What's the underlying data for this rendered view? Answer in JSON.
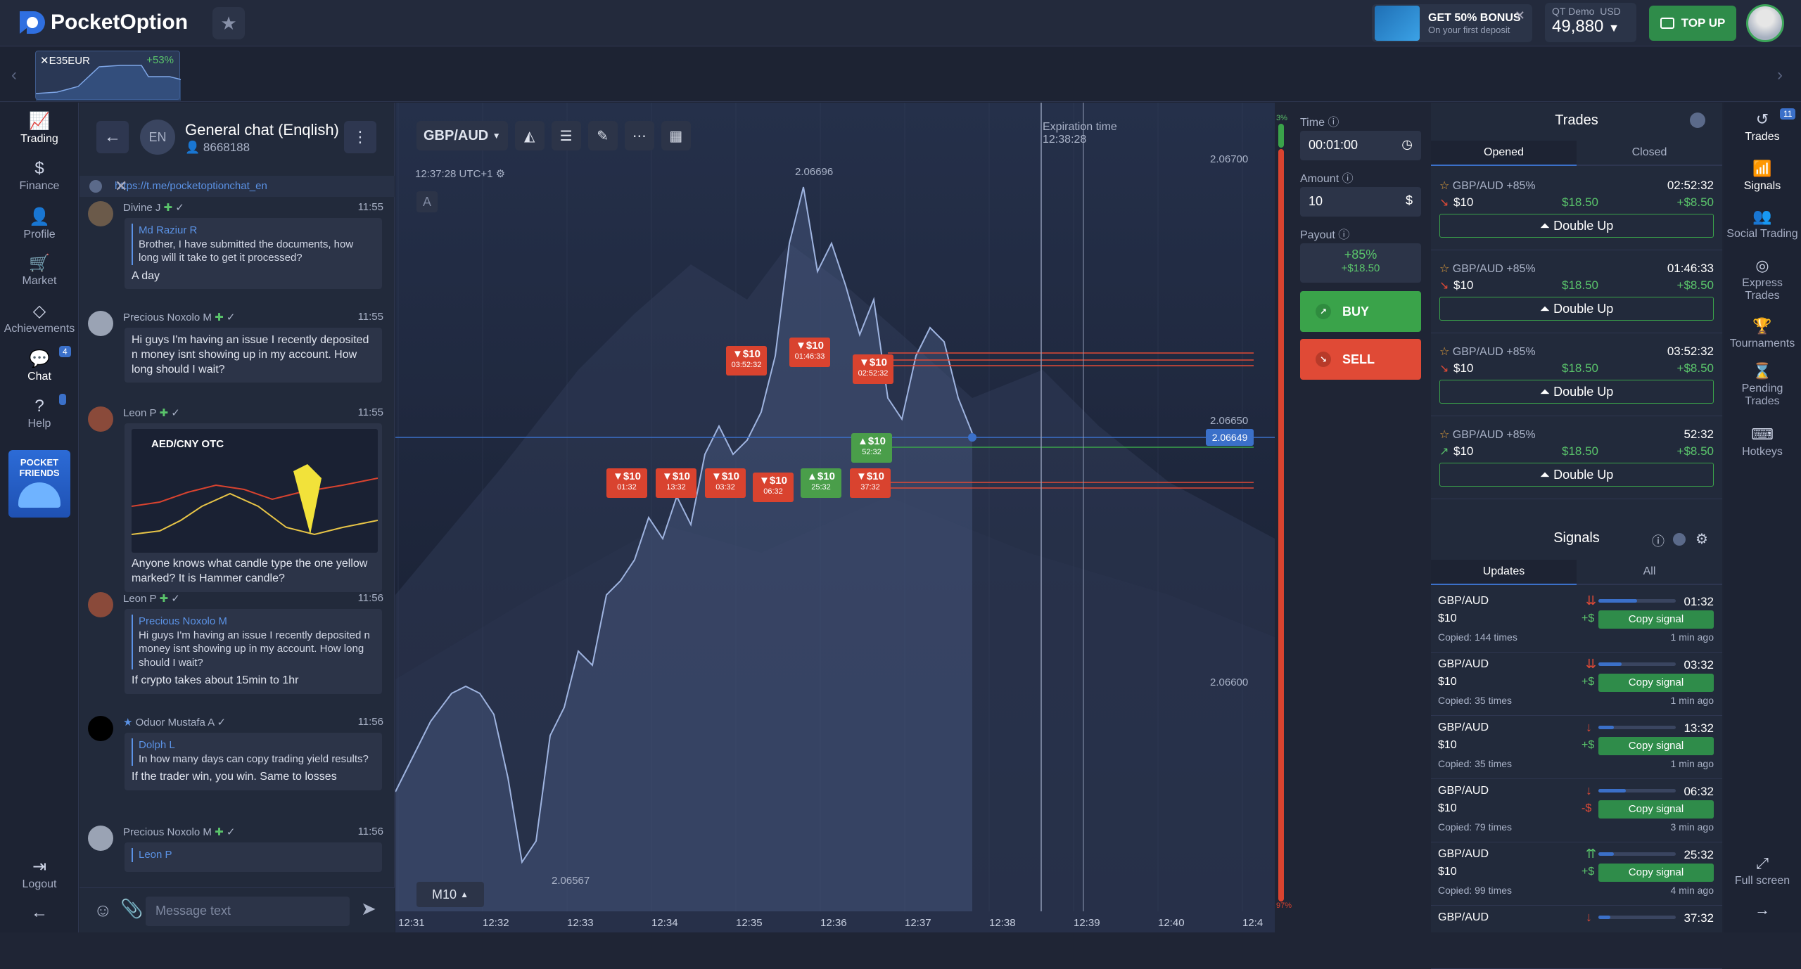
{
  "app": {
    "brand_prefix": "Pocket",
    "brand_suffix": "Option"
  },
  "header": {
    "bonus_title": "GET 50% BONUS",
    "bonus_sub": "On your first deposit",
    "account_mode": "QT Demo",
    "currency": "USD",
    "balance": "49,880",
    "topup_label": "TOP UP"
  },
  "asset_tab": {
    "name": "E35EUR",
    "pct": "+53%"
  },
  "left_nav": {
    "trading": "Trading",
    "finance": "Finance",
    "profile": "Profile",
    "market": "Market",
    "achievements": "Achievements",
    "chat": "Chat",
    "chat_badge": "4",
    "help": "Help",
    "promo_line1": "POCKET",
    "promo_line2": "FRIENDS",
    "logout": "Logout"
  },
  "chat": {
    "avatar": "EN",
    "title": "General chat (Enqlish)",
    "count": "8668188",
    "link": "https://t.me/pocketoptionchat_en",
    "input_placeholder": "Message text",
    "messages": [
      {
        "name": "Divine J",
        "time": "11:55",
        "quote_name": "Md Raziur R",
        "quote_text": "Brother, I have submitted the documents, how long will it take to get it processed?",
        "text": "A day"
      },
      {
        "name": "Precious Noxolo M",
        "time": "11:55",
        "text": "Hi guys I'm having an issue I recently deposited n money isnt showing up in my account. How long should I wait?"
      },
      {
        "name": "Leon P",
        "time": "11:55",
        "text": "Anyone knows what candle type the one yellow marked? It is Hammer candle?",
        "img_pair": "AED/CNY OTC"
      },
      {
        "name": "Leon P",
        "time": "11:56",
        "quote_name": "Precious Noxolo M",
        "quote_text": "Hi guys I'm having an issue I recently deposited n money isnt showing up in my account. How long should I wait?",
        "text": "If crypto takes about 15min to 1hr"
      },
      {
        "name": "Oduor Mustafa A",
        "time": "11:56",
        "quote_name": "Dolph L",
        "quote_text": "In how many days can copy trading yield results?",
        "text": "If the trader win, you win. Same to losses"
      },
      {
        "name": "Precious Noxolo M",
        "time": "11:56",
        "quote_name": "Leon P",
        "quote_text": "",
        "text": ""
      }
    ]
  },
  "chart": {
    "pair": "GBP/AUD",
    "time": "12:37:28 UTC+1",
    "mark_a": "A",
    "expiration_label": "Expiration time",
    "expiration_time": "12:38:28",
    "timeframe": "M10",
    "current_price": "2.06649",
    "high_label": "2.06696",
    "low_label": "2.06567",
    "price_ticks": [
      "2.06700",
      "2.06650",
      "2.06600"
    ],
    "x_ticks": [
      "12:31",
      "12:32",
      "12:33",
      "12:34",
      "12:35",
      "12:36",
      "12:37",
      "12:38",
      "12:39",
      "12:40",
      "12:4"
    ],
    "vbar_top": "3%",
    "vbar_bottom": "97%",
    "trade_tags": [
      {
        "amount": "$10",
        "timer": "03:52:32",
        "dir": "down"
      },
      {
        "amount": "$10",
        "timer": "01:46:33",
        "dir": "down"
      },
      {
        "amount": "$10",
        "timer": "02:52:32",
        "dir": "down"
      },
      {
        "amount": "$10",
        "timer": "52:32",
        "dir": "up"
      },
      {
        "amount": "$10",
        "timer": "01:32",
        "dir": "down"
      },
      {
        "amount": "$10",
        "timer": "13:32",
        "dir": "down"
      },
      {
        "amount": "$10",
        "timer": "03:32",
        "dir": "down"
      },
      {
        "amount": "$10",
        "timer": "06:32",
        "dir": "down"
      },
      {
        "amount": "$10",
        "timer": "25:32",
        "dir": "up"
      },
      {
        "amount": "$10",
        "timer": "37:32",
        "dir": "down"
      }
    ]
  },
  "controls": {
    "time_label": "Time",
    "time_value": "00:01:00",
    "amount_label": "Amount",
    "amount_value": "10",
    "payout_label": "Payout",
    "payout_pct": "+85%",
    "payout_amt": "+$18.50",
    "buy": "BUY",
    "sell": "SELL"
  },
  "trades": {
    "title": "Trades",
    "tab_opened": "Opened",
    "tab_closed": "Closed",
    "items": [
      {
        "pair": "GBP/AUD +85%",
        "time": "02:52:32",
        "amount": "$10",
        "payout": "$18.50",
        "profit": "+$8.50",
        "double": "Double Up"
      },
      {
        "pair": "GBP/AUD +85%",
        "time": "01:46:33",
        "amount": "$10",
        "payout": "$18.50",
        "profit": "+$8.50",
        "double": "Double Up"
      },
      {
        "pair": "GBP/AUD +85%",
        "time": "03:52:32",
        "amount": "$10",
        "payout": "$18.50",
        "profit": "+$8.50",
        "double": "Double Up"
      },
      {
        "pair": "GBP/AUD +85%",
        "time": "52:32",
        "amount": "$10",
        "payout": "$18.50",
        "profit": "+$8.50",
        "double": "Double Up"
      }
    ]
  },
  "signals": {
    "title": "Signals",
    "tab_updates": "Updates",
    "tab_all": "All",
    "items": [
      {
        "pair": "GBP/AUD",
        "time": "01:32",
        "amount": "$10",
        "sign": "+$",
        "copy": "Copy signal",
        "copied": "Copied: 144 times",
        "ago": "1 min ago",
        "dir": "down2",
        "progress": 0.5
      },
      {
        "pair": "GBP/AUD",
        "time": "03:32",
        "amount": "$10",
        "sign": "+$",
        "copy": "Copy signal",
        "copied": "Copied: 35 times",
        "ago": "1 min ago",
        "dir": "down2",
        "progress": 0.3
      },
      {
        "pair": "GBP/AUD",
        "time": "13:32",
        "amount": "$10",
        "sign": "+$",
        "copy": "Copy signal",
        "copied": "Copied: 35 times",
        "ago": "1 min ago",
        "dir": "down",
        "progress": 0.2
      },
      {
        "pair": "GBP/AUD",
        "time": "06:32",
        "amount": "$10",
        "sign": "-$",
        "copy": "Copy signal",
        "copied": "Copied: 79 times",
        "ago": "3 min ago",
        "dir": "down",
        "progress": 0.35
      },
      {
        "pair": "GBP/AUD",
        "time": "25:32",
        "amount": "$10",
        "sign": "+$",
        "copy": "Copy signal",
        "copied": "Copied: 99 times",
        "ago": "4 min ago",
        "dir": "up2",
        "progress": 0.2
      },
      {
        "pair": "GBP/AUD",
        "time": "37:32",
        "amount": "",
        "sign": "",
        "copy": "",
        "copied": "",
        "ago": "",
        "dir": "down",
        "progress": 0.15
      }
    ]
  },
  "right_nav": {
    "trades": "Trades",
    "trades_badge": "11",
    "signals": "Signals",
    "social": "Social Trading",
    "express_l1": "Express",
    "express_l2": "Trades",
    "tournaments": "Tournaments",
    "pending_l1": "Pending",
    "pending_l2": "Trades",
    "hotkeys": "Hotkeys",
    "fullscreen": "Full screen"
  }
}
